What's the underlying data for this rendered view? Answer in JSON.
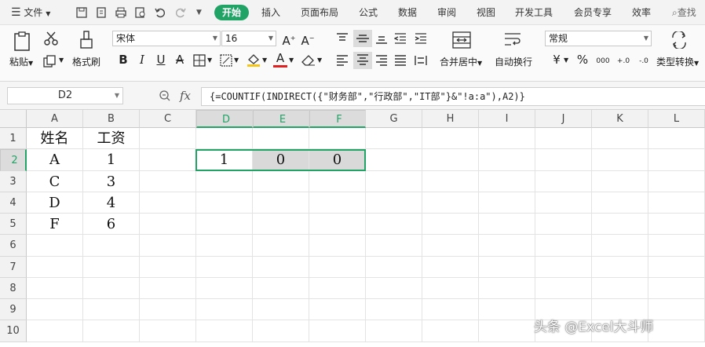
{
  "menubar": {
    "file": "文件",
    "tabs": [
      "开始",
      "插入",
      "页面布局",
      "公式",
      "数据",
      "审阅",
      "视图",
      "开发工具",
      "会员专享",
      "效率"
    ],
    "search": "查找"
  },
  "ribbon": {
    "paste": "粘贴",
    "format_painter": "格式刷",
    "font_name": "宋体",
    "font_size": "16",
    "merge_center": "合并居中",
    "wrap_text": "自动换行",
    "number_format": "常规",
    "type_convert": "类型转换",
    "bold": "B",
    "italic": "I",
    "underline": "U",
    "strike": "A",
    "font_color": "A",
    "percent": "%",
    "currency": "¥",
    "thousands": "000",
    "dec_inc": "+.0",
    "dec_dec": "-.0",
    "grow_font": "A+",
    "shrink_font": "A-"
  },
  "formula_bar": {
    "name_box": "D2",
    "fx": "fx",
    "formula": "{=COUNTIF(INDIRECT({\"财务部\",\"行政部\",\"IT部\"}&\"!a:a\"),A2)}"
  },
  "columns": [
    "A",
    "B",
    "C",
    "D",
    "E",
    "F",
    "G",
    "H",
    "I",
    "J",
    "K",
    "L"
  ],
  "rows": [
    "1",
    "2",
    "3",
    "4",
    "5",
    "6",
    "7",
    "8",
    "9",
    "10"
  ],
  "cells": {
    "A1": "姓名",
    "B1": "工资",
    "A2": "A",
    "B2": "1",
    "A3": "C",
    "B3": "3",
    "A4": "D",
    "B4": "4",
    "A5": "F",
    "B5": "6",
    "D2": "1",
    "E2": "0",
    "F2": "0"
  },
  "selected_cell": "D2",
  "accent_color": "#21a366",
  "watermark": "头条 @Excel大斗师"
}
